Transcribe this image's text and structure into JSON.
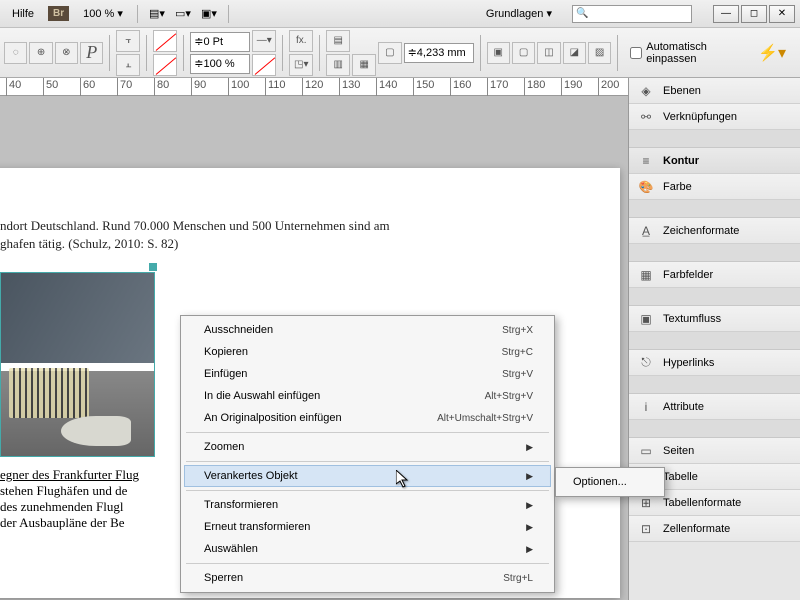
{
  "titlebar": {
    "help": "Hilfe",
    "bridge_badge": "Br",
    "zoom": "100 %",
    "workspace": "Grundlagen"
  },
  "toolbar": {
    "stroke_pt": "0 Pt",
    "scale_pct": "100 %",
    "frame_mm": "4,233 mm",
    "autofit": "Automatisch einpassen"
  },
  "ruler": {
    "marks": [
      "40",
      "50",
      "60",
      "70",
      "80",
      "90",
      "100",
      "110",
      "120",
      "130",
      "140",
      "150",
      "160",
      "170",
      "180",
      "190",
      "200"
    ]
  },
  "document": {
    "line1": "ndort Deutschland. Rund 70.000 Menschen und 500 Unternehmen sind am",
    "line2": "ghafen tätig. (Schulz, 2010: S. 82)",
    "caption": "egner des Frankfurter Flug",
    "more1": "stehen Flughäfen und de",
    "more2": "des zunehmenden Flugl",
    "more3": "der Ausbaupläne der Be"
  },
  "context_menu": {
    "items": [
      {
        "label": "Ausschneiden",
        "shortcut": "Strg+X"
      },
      {
        "label": "Kopieren",
        "shortcut": "Strg+C"
      },
      {
        "label": "Einfügen",
        "shortcut": "Strg+V"
      },
      {
        "label": "In die Auswahl einfügen",
        "shortcut": "Alt+Strg+V"
      },
      {
        "label": "An Originalposition einfügen",
        "shortcut": "Alt+Umschalt+Strg+V"
      },
      {
        "sep": true
      },
      {
        "label": "Zoomen",
        "submenu": true
      },
      {
        "sep": true
      },
      {
        "label": "Verankertes Objekt",
        "submenu": true,
        "hover": true
      },
      {
        "sep": true
      },
      {
        "label": "Transformieren",
        "submenu": true
      },
      {
        "label": "Erneut transformieren",
        "submenu": true
      },
      {
        "label": "Auswählen",
        "submenu": true
      },
      {
        "sep": true
      },
      {
        "label": "Sperren",
        "shortcut": "Strg+L"
      }
    ],
    "submenu_option": "Optionen..."
  },
  "panels": {
    "items": [
      {
        "icon": "◈",
        "label": "Ebenen"
      },
      {
        "icon": "⚯",
        "label": "Verknüpfungen"
      },
      {
        "spacer": true
      },
      {
        "icon": "≡",
        "label": "Kontur",
        "hdr": true
      },
      {
        "icon": "🎨",
        "label": "Farbe"
      },
      {
        "spacer": true
      },
      {
        "icon": "A̲",
        "label": "Zeichenformate"
      },
      {
        "spacer": true
      },
      {
        "icon": "▦",
        "label": "Farbfelder"
      },
      {
        "spacer": true
      },
      {
        "icon": "▣",
        "label": "Textumfluss"
      },
      {
        "spacer": true
      },
      {
        "icon": "⎋",
        "label": "Hyperlinks"
      },
      {
        "spacer": true
      },
      {
        "icon": "i",
        "label": "Attribute"
      },
      {
        "spacer": true
      },
      {
        "icon": "▭",
        "label": "Seiten"
      },
      {
        "icon": "▦",
        "label": "Tabelle"
      },
      {
        "icon": "⊞",
        "label": "Tabellenformate"
      },
      {
        "icon": "⊡",
        "label": "Zellenformate"
      }
    ]
  }
}
